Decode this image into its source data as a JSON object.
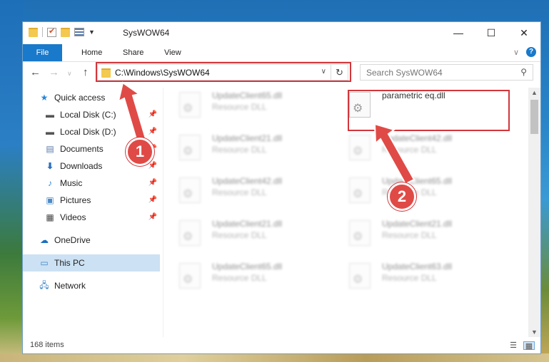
{
  "window": {
    "title": "SysWOW64",
    "minimize_glyph": "—",
    "maximize_glyph": "☐",
    "close_glyph": "✕"
  },
  "ribbon": {
    "tabs": [
      "File",
      "Home",
      "Share",
      "View"
    ]
  },
  "navigation": {
    "address": "C:\\Windows\\SysWOW64",
    "search_placeholder": "Search SysWOW64"
  },
  "sidebar": {
    "items": [
      {
        "label": "Quick access",
        "icon": "star-icon"
      },
      {
        "label": "Local Disk (C:)",
        "icon": "drive-icon",
        "pinned": true
      },
      {
        "label": "Local Disk (D:)",
        "icon": "drive-icon",
        "pinned": true
      },
      {
        "label": "Documents",
        "icon": "documents-icon",
        "pinned": true
      },
      {
        "label": "Downloads",
        "icon": "download-arrow-icon",
        "pinned": true
      },
      {
        "label": "Music",
        "icon": "music-note-icon",
        "pinned": true
      },
      {
        "label": "Pictures",
        "icon": "pictures-icon",
        "pinned": true
      },
      {
        "label": "Videos",
        "icon": "film-icon",
        "pinned": true
      },
      {
        "label": "OneDrive",
        "icon": "cloud-icon"
      },
      {
        "label": "This PC",
        "icon": "monitor-icon",
        "selected": true
      },
      {
        "label": "Network",
        "icon": "network-icon"
      }
    ]
  },
  "files": [
    {
      "name": "UpdateClient65.dll",
      "type": "Resource DLL",
      "blurred": true
    },
    {
      "name": "parametric eq.dll",
      "type": "",
      "blurred": false
    },
    {
      "name": "UpdateClient21.dll",
      "type": "Resource DLL",
      "blurred": true
    },
    {
      "name": "UpdateClient42.dll",
      "type": "Resource DLL",
      "blurred": true
    },
    {
      "name": "UpdateClient42.dll",
      "type": "Resource DLL",
      "blurred": true
    },
    {
      "name": "UpdateClient65.dll",
      "type": "Resource DLL",
      "blurred": true
    },
    {
      "name": "UpdateClient21.dll",
      "type": "Resource DLL",
      "blurred": true
    },
    {
      "name": "UpdateClient21.dll",
      "type": "Resource DLL",
      "blurred": true
    },
    {
      "name": "UpdateClient65.dll",
      "type": "Resource DLL",
      "blurred": true
    },
    {
      "name": "UpdateClient63.dll",
      "type": "Resource DLL",
      "blurred": true
    }
  ],
  "status": {
    "item_count": "168 items"
  },
  "annotations": {
    "step1": "1",
    "step2": "2",
    "highlight_color": "#d2363b"
  }
}
